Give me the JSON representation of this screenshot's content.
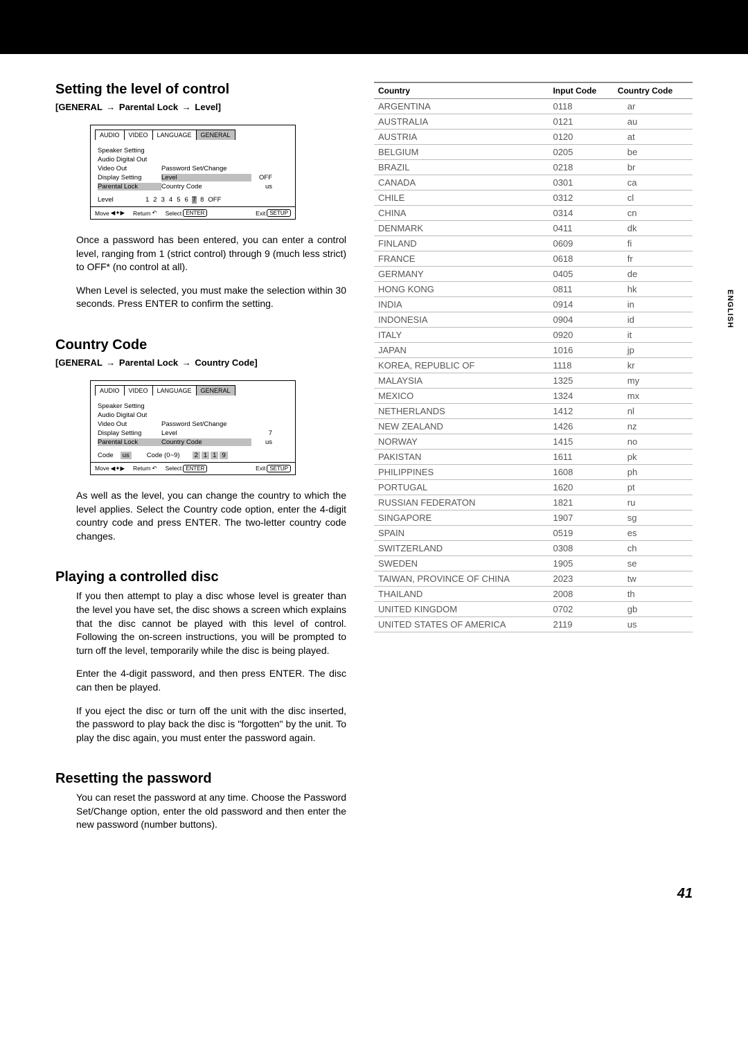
{
  "section1": {
    "title": "Setting the level of control",
    "breadcrumb": {
      "a": "[GENERAL",
      "b": "Parental Lock",
      "c": "Level]"
    },
    "p1": "Once a password has been entered, you can enter a control level, ranging from 1 (strict control) through 9 (much less strict) to OFF* (no control at all).",
    "p2": "When Level is selected, you must make the selection within 30 seconds. Press ENTER to confirm the setting."
  },
  "section2": {
    "title": "Country Code",
    "breadcrumb": {
      "a": "[GENERAL",
      "b": "Parental Lock",
      "c": "Country Code]"
    },
    "p1": "As well as the level, you can change the country to which the level applies. Select the Country code option, enter the 4-digit country code and press ENTER. The two-letter country code changes."
  },
  "section3": {
    "title": "Playing a controlled disc",
    "p1": "If you then attempt to play a disc whose level is greater than the level you have set, the disc shows a screen which explains that the disc cannot be played with this level of control. Following the on-screen instructions, you will be prompted to turn off the level, temporarily while the disc is being played.",
    "p2": "Enter the 4-digit password, and then press ENTER. The disc can then be played.",
    "p3": "If you eject the disc or turn off the unit with the disc inserted, the password to play back the disc is \"forgotten\" by the unit. To play the disc again, you must enter the password again."
  },
  "section4": {
    "title": "Resetting the password",
    "p1": "You can reset the password at any time. Choose the Password Set/Change option, enter the old password and then enter the new password (number buttons)."
  },
  "osd_common": {
    "tabs": [
      "AUDIO",
      "VIDEO",
      "LANGUAGE",
      "GENERAL"
    ],
    "rows": {
      "speaker": "Speaker Setting",
      "ado": "Audio Digital Out",
      "vo": "Video Out",
      "ds": "Display Setting",
      "pl": "Parental Lock",
      "pwd": "Password Set/Change",
      "level": "Level",
      "cc": "Country Code"
    },
    "level_off": "OFF",
    "level_val7": "7",
    "cc_us": "us",
    "foot": {
      "move": "Move",
      "return": "Return",
      "select": "Select",
      "enter": "ENTER",
      "exit": "Exit",
      "setup": "SETUP"
    }
  },
  "osd_level": {
    "label": "Level",
    "nums": [
      "1",
      "2",
      "3",
      "4",
      "5",
      "6",
      "7",
      "8",
      "OFF"
    ],
    "sel_index": 6
  },
  "osd_cc": {
    "label": "Code",
    "box": "us",
    "label2": "Code (0~9)",
    "digits": [
      "2",
      "1",
      "1",
      "9"
    ]
  },
  "lang_tab": "ENGLISH",
  "table": {
    "headers": {
      "country": "Country",
      "input": "Input Code",
      "cc": "Country Code"
    },
    "rows": [
      {
        "c": "ARGENTINA",
        "i": "0118",
        "cc": "ar"
      },
      {
        "c": "AUSTRALIA",
        "i": "0121",
        "cc": "au"
      },
      {
        "c": "AUSTRIA",
        "i": "0120",
        "cc": "at"
      },
      {
        "c": "BELGIUM",
        "i": "0205",
        "cc": "be"
      },
      {
        "c": "BRAZIL",
        "i": "0218",
        "cc": "br"
      },
      {
        "c": "CANADA",
        "i": "0301",
        "cc": "ca"
      },
      {
        "c": "CHILE",
        "i": "0312",
        "cc": "cl"
      },
      {
        "c": "CHINA",
        "i": "0314",
        "cc": "cn"
      },
      {
        "c": "DENMARK",
        "i": "0411",
        "cc": "dk"
      },
      {
        "c": "FINLAND",
        "i": "0609",
        "cc": "fi"
      },
      {
        "c": "FRANCE",
        "i": "0618",
        "cc": "fr"
      },
      {
        "c": "GERMANY",
        "i": "0405",
        "cc": "de"
      },
      {
        "c": "HONG KONG",
        "i": "0811",
        "cc": "hk"
      },
      {
        "c": "INDIA",
        "i": "0914",
        "cc": "in"
      },
      {
        "c": "INDONESIA",
        "i": "0904",
        "cc": "id"
      },
      {
        "c": "ITALY",
        "i": "0920",
        "cc": "it"
      },
      {
        "c": "JAPAN",
        "i": "1016",
        "cc": "jp"
      },
      {
        "c": "KOREA, REPUBLIC OF",
        "i": "1118",
        "cc": "kr"
      },
      {
        "c": "MALAYSIA",
        "i": "1325",
        "cc": "my"
      },
      {
        "c": "MEXICO",
        "i": "1324",
        "cc": "mx"
      },
      {
        "c": "NETHERLANDS",
        "i": "1412",
        "cc": "nl"
      },
      {
        "c": "NEW ZEALAND",
        "i": "1426",
        "cc": "nz"
      },
      {
        "c": "NORWAY",
        "i": "1415",
        "cc": "no"
      },
      {
        "c": "PAKISTAN",
        "i": "1611",
        "cc": "pk"
      },
      {
        "c": "PHILIPPINES",
        "i": "1608",
        "cc": "ph"
      },
      {
        "c": "PORTUGAL",
        "i": "1620",
        "cc": "pt"
      },
      {
        "c": "RUSSIAN FEDERATON",
        "i": "1821",
        "cc": "ru"
      },
      {
        "c": "SINGAPORE",
        "i": "1907",
        "cc": "sg"
      },
      {
        "c": "SPAIN",
        "i": "0519",
        "cc": "es"
      },
      {
        "c": "SWITZERLAND",
        "i": "0308",
        "cc": "ch"
      },
      {
        "c": "SWEDEN",
        "i": "1905",
        "cc": "se"
      },
      {
        "c": "TAIWAN, PROVINCE OF CHINA",
        "i": "2023",
        "cc": "tw"
      },
      {
        "c": "THAILAND",
        "i": "2008",
        "cc": "th"
      },
      {
        "c": "UNITED KINGDOM",
        "i": "0702",
        "cc": "gb"
      },
      {
        "c": "UNITED STATES OF AMERICA",
        "i": "2119",
        "cc": "us"
      }
    ]
  },
  "page_number": "41"
}
